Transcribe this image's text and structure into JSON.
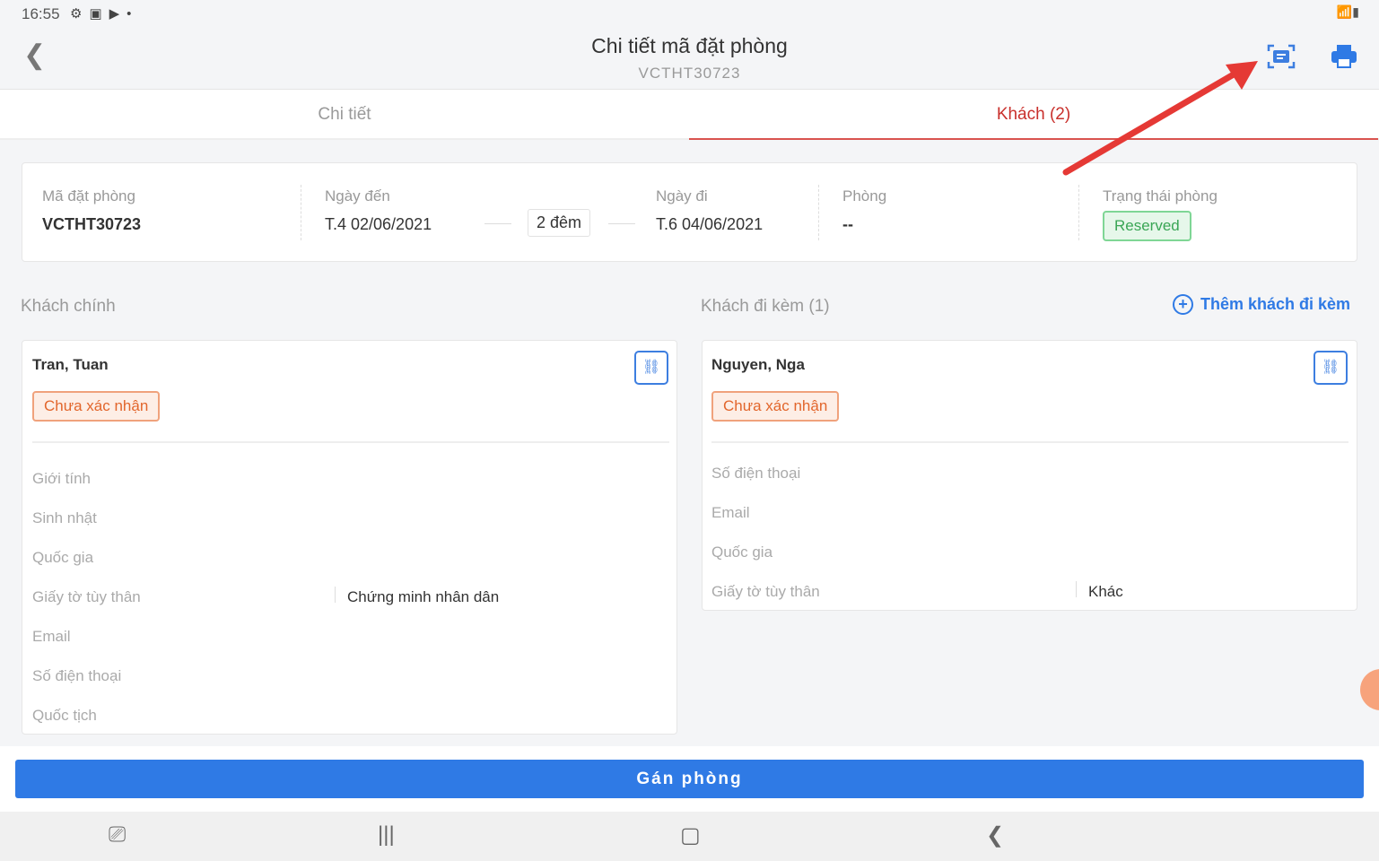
{
  "status_bar": {
    "time": "16:55"
  },
  "header": {
    "title": "Chi tiết mã đặt phòng",
    "subtitle": "VCTHT30723"
  },
  "tabs": [
    {
      "label": "Chi tiết"
    },
    {
      "label": "Khách (2)"
    }
  ],
  "booking": {
    "code_label": "Mã đặt phòng",
    "code": "VCTHT30723",
    "arrival_label": "Ngày đến",
    "arrival": "T.4 02/06/2021",
    "nights": "2 đêm",
    "departure_label": "Ngày đi",
    "departure": "T.6 04/06/2021",
    "room_label": "Phòng",
    "room": "--",
    "status_label": "Trạng thái phòng",
    "status": "Reserved"
  },
  "main_guest": {
    "section": "Khách chính",
    "name": "Tran, Tuan",
    "badge": "Chưa xác nhận",
    "fields": [
      {
        "label": "Giới tính",
        "value": ""
      },
      {
        "label": "Sinh nhật",
        "value": ""
      },
      {
        "label": "Quốc gia",
        "value": ""
      },
      {
        "label": "Giấy tờ tùy thân",
        "value": "Chứng minh nhân dân"
      },
      {
        "label": "Email",
        "value": ""
      },
      {
        "label": "Số điện thoại",
        "value": ""
      },
      {
        "label": "Quốc tịch",
        "value": ""
      }
    ]
  },
  "companion": {
    "section": "Khách đi kèm (1)",
    "add_label": "Thêm khách đi kèm",
    "name": "Nguyen, Nga",
    "badge": "Chưa xác nhận",
    "fields": [
      {
        "label": "Số điện thoại",
        "value": ""
      },
      {
        "label": "Email",
        "value": ""
      },
      {
        "label": "Quốc gia",
        "value": ""
      },
      {
        "label": "Giấy tờ tùy thân",
        "value": "Khác"
      }
    ]
  },
  "assign_button": "Gán phòng",
  "colors": {
    "accent": "#2f7ae5",
    "tab_active": "#c9302c",
    "annotation": "#e53935"
  }
}
